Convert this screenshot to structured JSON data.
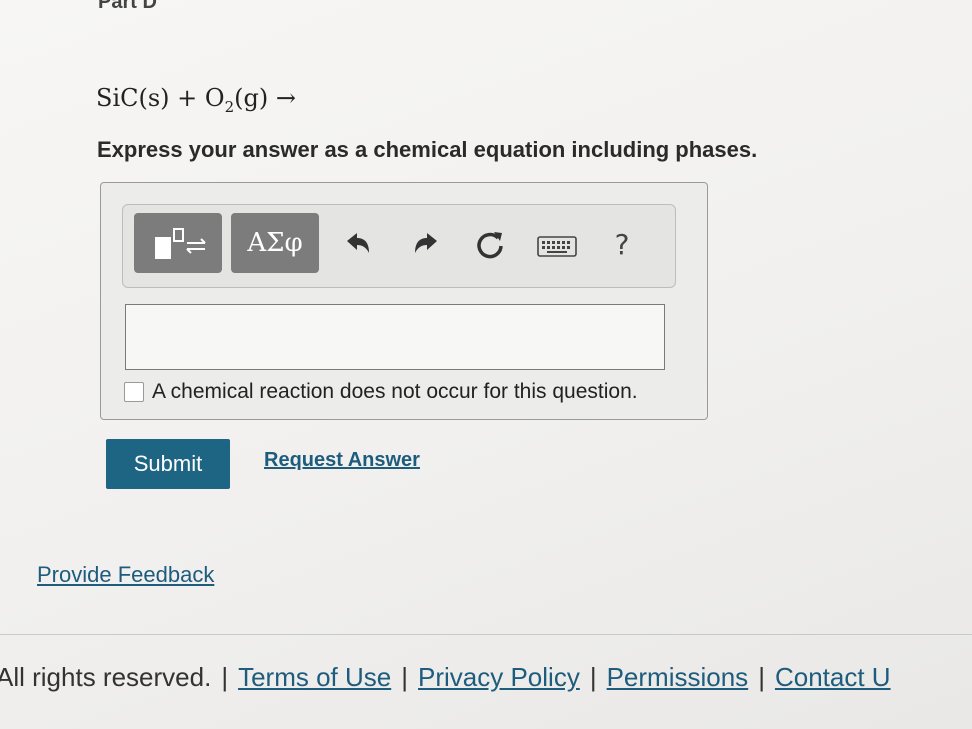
{
  "part": {
    "label": "Part D"
  },
  "question": {
    "reactant1": "SiC(s)",
    "plus": "+",
    "o2_main": "O",
    "o2_subscript": "2",
    "o2_phase": "(g)",
    "arrow": "→",
    "instruction": "Express your answer as a chemical equation including phases."
  },
  "toolbar": {
    "greek_label": "ΑΣφ",
    "help_label": "?",
    "icons": [
      "template-icon",
      "undo-icon",
      "redo-icon",
      "reset-icon",
      "keyboard-icon"
    ]
  },
  "answer": {
    "value": "",
    "no_reaction_label": "A chemical reaction does not occur for this question.",
    "no_reaction_checked": false
  },
  "actions": {
    "submit_label": "Submit",
    "request_answer_label": "Request Answer"
  },
  "feedback": {
    "label": "Provide Feedback"
  },
  "footer": {
    "rights": "All rights reserved.",
    "separator": "|",
    "links": [
      "Terms of Use",
      "Privacy Policy",
      "Permissions",
      "Contact U"
    ]
  },
  "colors": {
    "primary_button": "#1d6583",
    "link": "#1d5c7d",
    "toolbar_button": "#7c7c7c"
  }
}
